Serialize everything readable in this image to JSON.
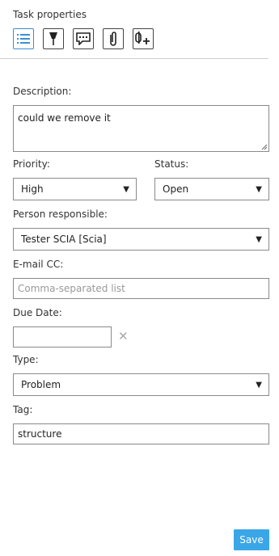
{
  "panel": {
    "title": "Task properties"
  },
  "toolbar": {
    "buttons": [
      {
        "icon": "list-icon",
        "active": true
      },
      {
        "icon": "pin-icon",
        "active": false
      },
      {
        "icon": "comment-icon",
        "active": false
      },
      {
        "icon": "paperclip-icon",
        "active": false
      },
      {
        "icon": "link-add-icon",
        "active": false
      }
    ]
  },
  "form": {
    "description": {
      "label": "Description:",
      "value": "could we remove it"
    },
    "priority": {
      "label": "Priority:",
      "value": "High"
    },
    "status": {
      "label": "Status:",
      "value": "Open"
    },
    "person_responsible": {
      "label": "Person responsible:",
      "value": "Tester SCIA [Scia]"
    },
    "email_cc": {
      "label": "E-mail CC:",
      "value": "",
      "placeholder": "Comma-separated list"
    },
    "due_date": {
      "label": "Due Date:",
      "value": ""
    },
    "type": {
      "label": "Type:",
      "value": "Problem"
    },
    "tag": {
      "label": "Tag:",
      "value": "structure"
    }
  },
  "actions": {
    "save_label": "Save"
  },
  "colors": {
    "accent": "#3aa6e8",
    "active_icon": "#3a8fd6",
    "border": "#8a8a8a"
  }
}
